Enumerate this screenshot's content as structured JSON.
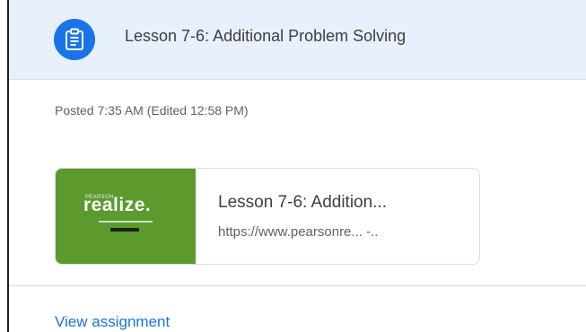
{
  "colors": {
    "header_bg": "#e8f0fe",
    "accent": "#1a73e8",
    "thumbnail_green": "#5b9a2d"
  },
  "header": {
    "icon": "assignment-clipboard-icon",
    "title": "Lesson 7-6: Additional Problem Solving"
  },
  "meta": {
    "posted": "Posted 7:35 AM (Edited 12:58 PM)"
  },
  "attachment": {
    "thumbnail_brand_small": "PEARSON",
    "thumbnail_brand_big": "realize.",
    "title": "Lesson 7-6: Addition...",
    "url": "https://www.pearsonre...  -.."
  },
  "actions": {
    "view_assignment": "View assignment"
  }
}
